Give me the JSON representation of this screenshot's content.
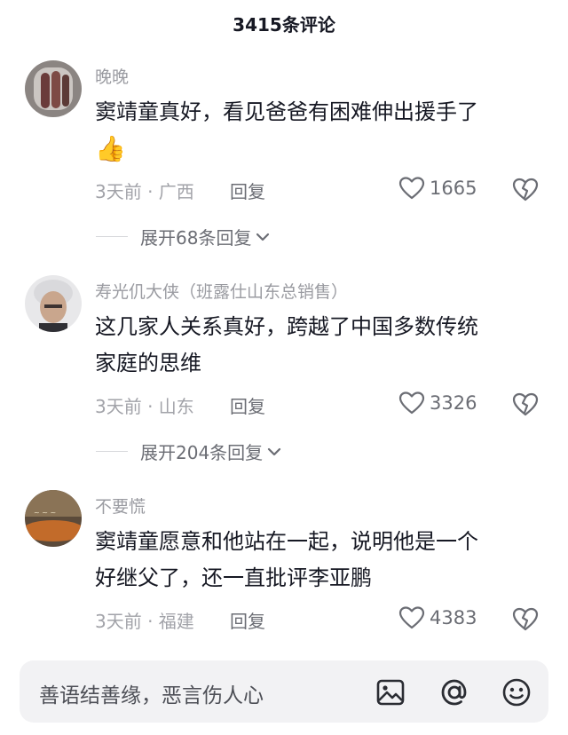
{
  "header": {
    "title": "3415条评论"
  },
  "comments": [
    {
      "username": "晚晚",
      "content_lines": [
        "窦靖童真好，看见爸爸有困难伸出援手了",
        "👍"
      ],
      "time_location": "3天前 · 广西",
      "reply_label": "回复",
      "likes": "1665",
      "expand_label": "展开68条回复"
    },
    {
      "username": "寿光仉大侠（班露仕山东总销售）",
      "content_lines": [
        "这几家人关系真好，跨越了中国多数传统",
        "家庭的思维"
      ],
      "time_location": "3天前 · 山东",
      "reply_label": "回复",
      "likes": "3326",
      "expand_label": "展开204条回复"
    },
    {
      "username": "不要慌",
      "content_lines": [
        "窦靖童愿意和他站在一起，说明他是一个",
        "好继父了，还一直批评李亚鹏"
      ],
      "time_location": "3天前 · 福建",
      "reply_label": "回复",
      "likes": "4383"
    }
  ],
  "input": {
    "placeholder": "善语结善缘，恶言伤人心"
  },
  "icons": {
    "heart": "heart-icon",
    "dislike": "broken-heart-icon",
    "chevron": "chevron-down-icon",
    "image": "image-icon",
    "mention": "at-icon",
    "emoji": "emoji-icon"
  },
  "colors": {
    "text": "#161823",
    "secondary": "#6b6d74",
    "muted": "#9a9ba1",
    "input_bg": "#f2f2f4"
  }
}
